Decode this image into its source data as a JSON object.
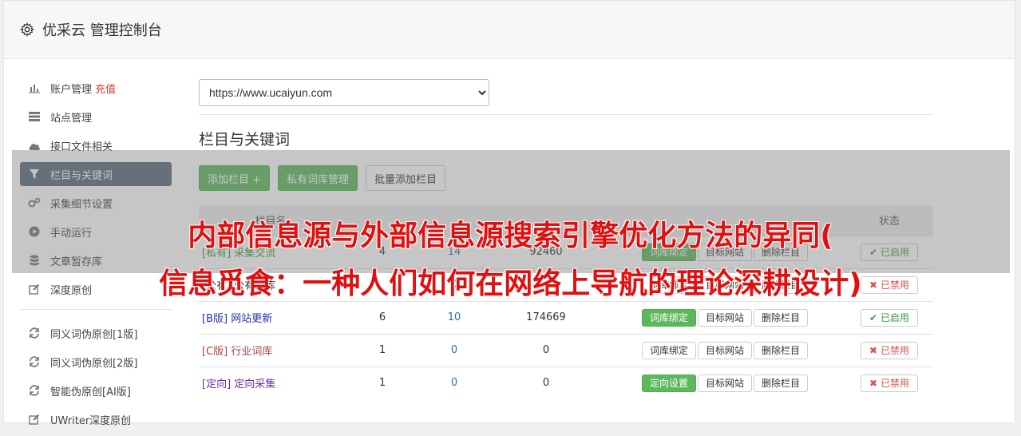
{
  "header": {
    "title": "优采云 管理控制台",
    "icon": "gear-icon"
  },
  "sidebar": {
    "items": [
      {
        "label": "账户管理",
        "extra": "充值",
        "icon": "bar-chart-icon"
      },
      {
        "label": "站点管理",
        "icon": "server-icon"
      },
      {
        "label": "接口文件相关",
        "icon": "cloud-upload-icon"
      },
      {
        "label": "栏目与关键词",
        "icon": "filter-icon",
        "active": true
      },
      {
        "label": "采集细节设置",
        "icon": "gears-icon"
      },
      {
        "label": "手动运行",
        "icon": "play-circle-icon"
      },
      {
        "label": "文章暂存库",
        "icon": "database-icon"
      },
      {
        "label": "深度原创",
        "icon": "edit-icon"
      }
    ],
    "items2": [
      {
        "label": "同义词伪原创[1版]",
        "icon": "refresh-icon"
      },
      {
        "label": "同义词伪原创[2版]",
        "icon": "refresh-icon"
      },
      {
        "label": "智能伪原创[AI版]",
        "icon": "refresh-icon"
      },
      {
        "label": "UWriter深度原创",
        "icon": "edit-icon"
      }
    ]
  },
  "main": {
    "site_select": "https://www.ucaiyun.com",
    "section_title": "栏目与关键词",
    "buttons": {
      "add_column": "添加栏目 +",
      "private_lib": "私有词库管理",
      "batch_add": "批量添加栏目"
    },
    "table": {
      "headers": [
        "栏目名",
        "",
        "",
        "",
        "",
        "状态"
      ],
      "rows": [
        {
          "tag": "[私有]",
          "name": "采集交流",
          "tag_class": "tag-private",
          "c1": "4",
          "c2": "14",
          "c3": "92460",
          "op1": "词库绑定",
          "op1_green": true,
          "op2": "目标网站",
          "op3": "删除栏目",
          "status": "已启用",
          "on": true
        },
        {
          "tag": "[公有]",
          "name": "公有词库",
          "tag_class": "tag-public",
          "c1": "",
          "c2": "0",
          "c3": "",
          "op1": "词库绑定",
          "op1_green": false,
          "op2": "目标网站",
          "op3": "删除栏目",
          "status": "已禁用",
          "on": false
        },
        {
          "tag": "[B版]",
          "name": "网站更新",
          "tag_class": "tag-b",
          "c1": "6",
          "c2": "10",
          "c3": "174669",
          "op1": "词库绑定",
          "op1_green": true,
          "op2": "目标网站",
          "op3": "删除栏目",
          "status": "已启用",
          "on": true
        },
        {
          "tag": "[C版]",
          "name": "行业词库",
          "tag_class": "tag-c",
          "c1": "1",
          "c2": "0",
          "c3": "0",
          "op1": "词库绑定",
          "op1_green": false,
          "op2": "目标网站",
          "op3": "删除栏目",
          "status": "已禁用",
          "on": false
        },
        {
          "tag": "[定向]",
          "name": "定向采集",
          "tag_class": "tag-d",
          "c1": "1",
          "c2": "0",
          "c3": "0",
          "op1": "定向设置",
          "op1_green": true,
          "op2": "目标网站",
          "op3": "删除栏目",
          "status": "已禁用",
          "on": false
        }
      ]
    }
  },
  "overlay": {
    "line1": "内部信息源与外部信息源搜索引擎优化方法的异同(",
    "line2": "信息觅食：一种人们如何在网络上导航的理论深耕设计)"
  },
  "colors": {
    "green": "#5cb85c",
    "active_nav": "#5a6b7e",
    "banner_red": "#e01010"
  }
}
